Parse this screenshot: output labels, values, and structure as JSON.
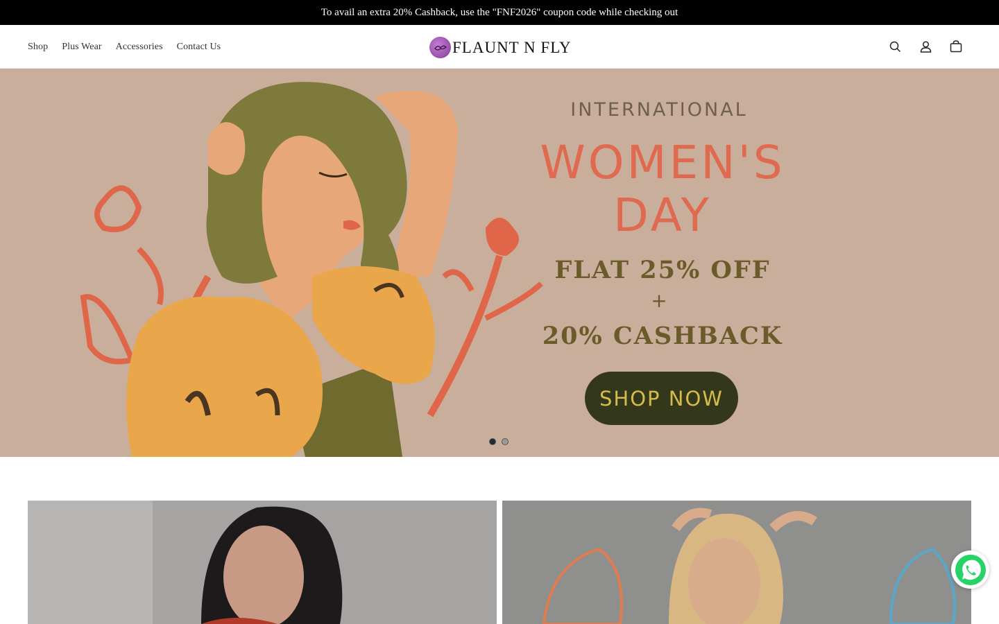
{
  "announcement": {
    "text": "To avail an extra 20% Cashback, use the \"FNF2026\" coupon code while checking out"
  },
  "header": {
    "nav": [
      "Shop",
      "Plus Wear",
      "Accessories",
      "Contact Us"
    ],
    "logo_text": "FLAUNT N FLY",
    "icons": [
      "search-icon",
      "account-icon",
      "cart-icon"
    ]
  },
  "hero": {
    "line1": "INTERNATIONAL",
    "line2": "WOMEN'S",
    "line3": "DAY",
    "offer1": "FLAT 25% OFF",
    "plus": "+",
    "offer2": "20% CASHBACK",
    "cta": "SHOP NOW",
    "slides_total": 2,
    "active_slide": 1,
    "colors": {
      "background": "#c9ae9b",
      "accent": "#e06a4f",
      "olive": "#6b5a2a",
      "button": "#34381b"
    }
  },
  "collections": {
    "cards": [
      {
        "alt": ""
      },
      {
        "alt": ""
      }
    ]
  },
  "floating": {
    "whatsapp": "whatsapp-icon"
  }
}
